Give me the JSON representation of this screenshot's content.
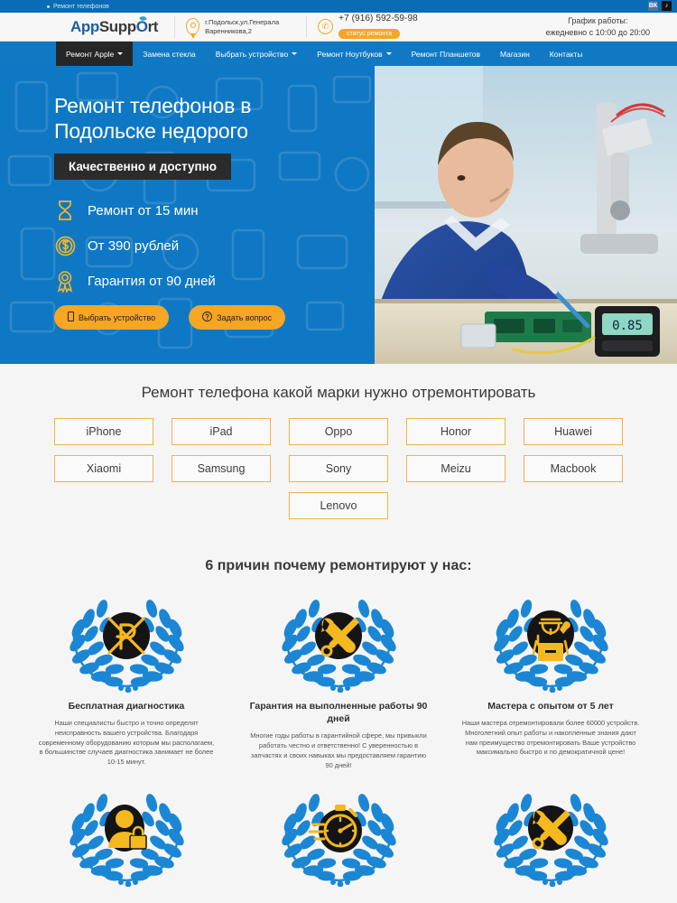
{
  "topbar": {
    "label": "Ремонт телефонов",
    "social": [
      {
        "name": "vk-icon",
        "glyph": "ВК"
      },
      {
        "name": "tiktok-icon",
        "glyph": "♪"
      }
    ]
  },
  "header": {
    "logo": {
      "part1": "App",
      "part2": "Supp",
      "part3": "O",
      "part4": "rt"
    },
    "address": "г.Подольск,ул.Генерала Варенникова,2",
    "address_line1": "г.Подольск,ул.Генерала",
    "address_line2": "Варенникова,2",
    "phone": "+7 (916) 592-59-98",
    "status_button": "статус ремонта",
    "hours_title": "График работы:",
    "hours_value": "ежедневно с 10:00 до 20:00"
  },
  "nav": {
    "items": [
      {
        "label": "Ремонт Apple",
        "caret": true,
        "active": true
      },
      {
        "label": "Замена стекла",
        "caret": false,
        "active": false
      },
      {
        "label": "Выбрать устройство",
        "caret": true,
        "active": false
      },
      {
        "label": "Ремонт Ноутбуков",
        "caret": true,
        "active": false
      },
      {
        "label": "Ремонт Планшетов",
        "caret": false,
        "active": false
      },
      {
        "label": "Магазин",
        "caret": false,
        "active": false
      },
      {
        "label": "Контакты",
        "caret": false,
        "active": false
      }
    ]
  },
  "hero": {
    "title_line1": "Ремонт телефонов в",
    "title_line2": "Подольске недорого",
    "badge": "Качественно и доступно",
    "features": [
      {
        "icon": "hourglass-icon",
        "text": "Ремонт от 15 мин"
      },
      {
        "icon": "coin-dollar-icon",
        "text": "От 390 рублей"
      },
      {
        "icon": "award-medal-icon",
        "text": "Гарантия от 90 дней"
      }
    ],
    "buttons": [
      {
        "icon": "phone-device-icon",
        "label": "Выбрать устройство"
      },
      {
        "icon": "question-mark-icon",
        "label": "Задать вопрос"
      }
    ]
  },
  "brands": {
    "title": "Ремонт телефона какой марки нужно отремонтировать",
    "row1": [
      "iPhone",
      "iPad",
      "Oppo",
      "Honor",
      "Huawei"
    ],
    "row2": [
      "Xiaomi",
      "Samsung",
      "Sony",
      "Meizu",
      "Macbook"
    ],
    "row3": [
      "Lenovo"
    ]
  },
  "reasons": {
    "title": "6 причин почему ремонтируют у нас:",
    "items": [
      {
        "icon": "crossed-ruble-icon",
        "heading": "Бесплатная диагностика",
        "text": "Наши специалисты быстро и точно определят неисправность вашего устройства. Благодаря современному оборудованию которым мы располагаем, в большинстве случаев диагностика занимает не более 10-15 минут."
      },
      {
        "icon": "wrench-screwdriver-icon",
        "heading": "Гарантия на выполненные работы 90 дней",
        "text": "Многие годы работы в гарантийной сфере, мы привыкли работать честно и ответственно! С уверенностью в запчастях и своих навыках мы предоставляем гарантию 90 дней!"
      },
      {
        "icon": "technician-icon",
        "heading": "Мастера с опытом от 5 лет",
        "text": "Наши мастера отремонтировали более 60000 устройств. Многолетний опыт работы и накопленные знания дают нам преимущество отремонтировать Ваше устройство максимально быстро и по демократичной цене!"
      },
      {
        "icon": "privacy-lock-icon",
        "heading": "",
        "text": ""
      },
      {
        "icon": "stopwatch-icon",
        "heading": "",
        "text": ""
      },
      {
        "icon": "tools-icon",
        "heading": "",
        "text": ""
      }
    ]
  },
  "colors": {
    "brand_blue": "#0f78c4",
    "nav_blue": "#1179c4",
    "accent_orange": "#f5a623",
    "border_orange": "#f0b24a",
    "dark": "#2b2b2b",
    "page_bg": "#f5f5f5",
    "wreath_blue": "#1b87d4"
  }
}
